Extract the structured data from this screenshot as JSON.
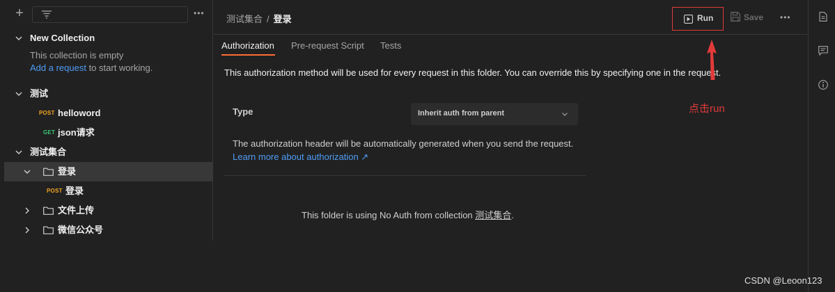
{
  "sidebar": {
    "items": [
      {
        "label": "New Collection"
      },
      {
        "label": "测试"
      },
      {
        "method": "POST",
        "label": "helloword"
      },
      {
        "method": "GET",
        "label": "json请求"
      },
      {
        "label": "测试集合"
      },
      {
        "label": "登录"
      },
      {
        "method": "POST",
        "label": "登录"
      },
      {
        "label": "文件上传"
      },
      {
        "label": "微信公众号"
      }
    ],
    "empty_text": "This collection is empty",
    "add_request_link": "Add a request",
    "add_request_suffix": " to start working."
  },
  "header": {
    "breadcrumb_parent": "测试集合",
    "breadcrumb_sep": "/",
    "breadcrumb_current": "登录",
    "run_label": "Run",
    "save_label": "Save"
  },
  "tabs": [
    {
      "label": "Authorization",
      "active": true
    },
    {
      "label": "Pre-request Script",
      "active": false
    },
    {
      "label": "Tests",
      "active": false
    }
  ],
  "auth": {
    "info": "This authorization method will be used for every request in this folder. You can override this by specifying one in the request.",
    "type_label": "Type",
    "type_value": "Inherit auth from parent",
    "description": "The authorization header will be automatically generated when you send the request.",
    "learn_more": "Learn more about authorization ↗",
    "folder_note_prefix": "This folder is using No Auth from collection ",
    "folder_note_link": "测试集合",
    "folder_note_suffix": "."
  },
  "annotation": {
    "text": "点击run",
    "color": "#e23a3a"
  },
  "watermark": "CSDN @Leoon123",
  "colors": {
    "accent": "#ff6c37",
    "link": "#4f9cf5",
    "post": "#f5a623",
    "get": "#3ac776"
  }
}
